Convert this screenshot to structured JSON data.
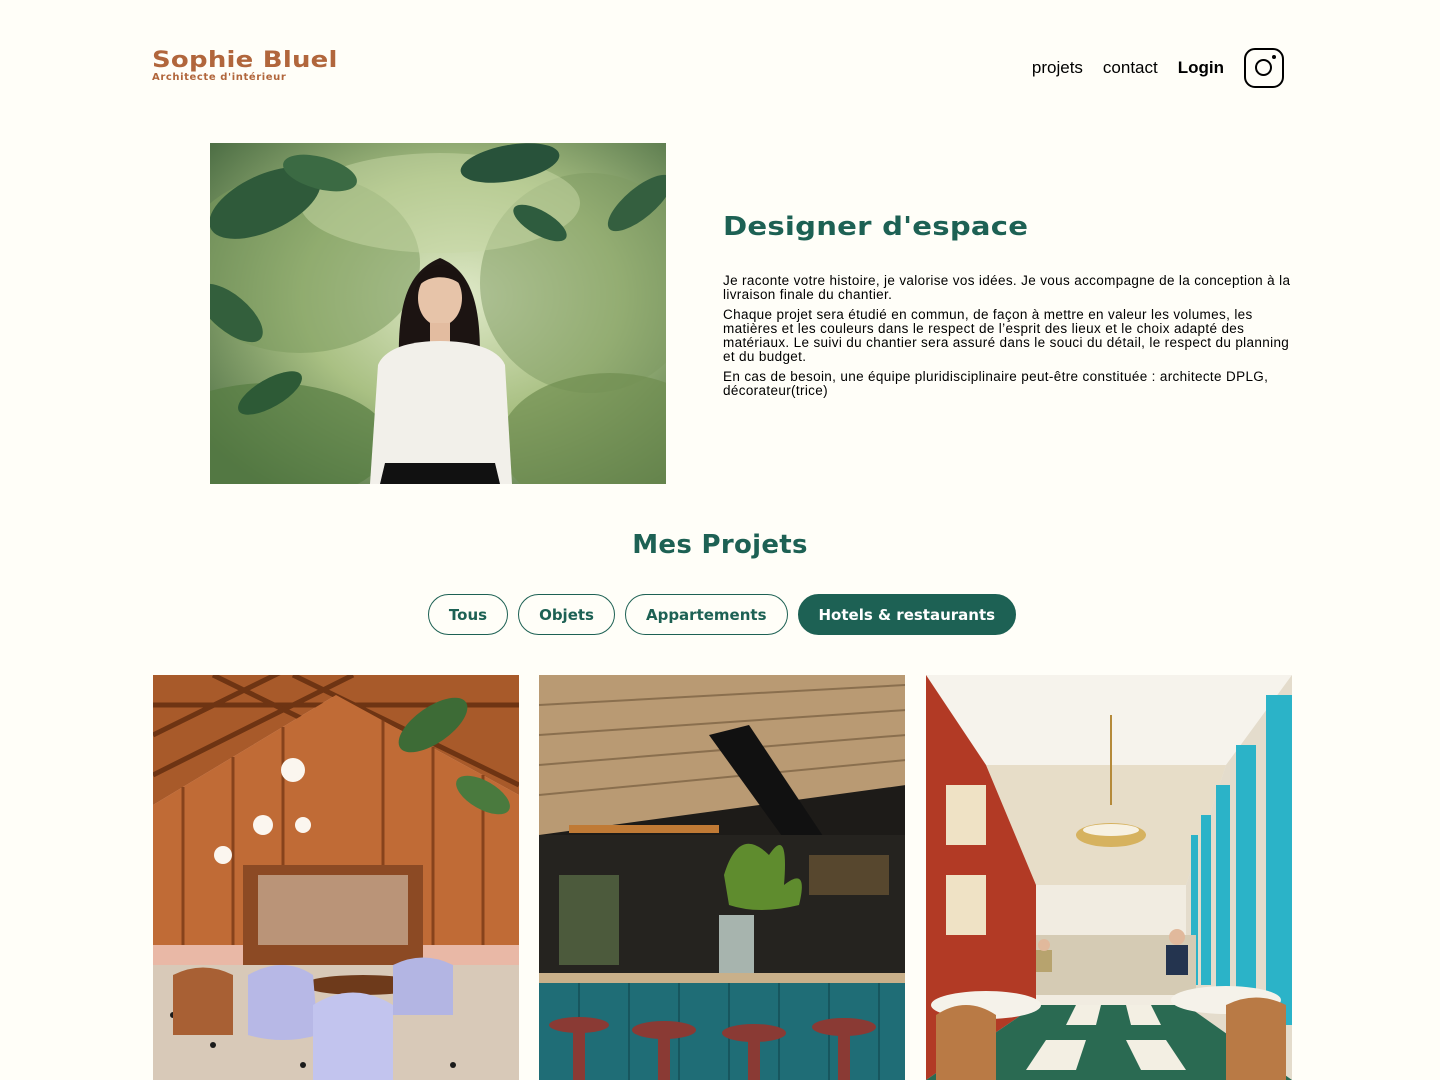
{
  "header": {
    "logo_title": "Sophie Bluel",
    "logo_subtitle": "Architecte d'intérieur",
    "nav": [
      "projets",
      "contact",
      "Login"
    ],
    "instagram_icon": "instagram-icon"
  },
  "intro": {
    "title": "Designer d'espace",
    "paragraphs": [
      "Je raconte votre histoire, je valorise vos idées. Je vous accompagne de la conception à la livraison finale du chantier.",
      "Chaque projet sera étudié en commun, de façon à mettre en valeur les volumes, les matières et les couleurs dans le respect de l’esprit des lieux et le choix adapté des matériaux. Le suivi du chantier sera assuré dans le souci du détail, le respect du planning et du budget.",
      "En cas de besoin, une équipe pluridisciplinaire peut-être constituée : architecte DPLG, décorateur(trice)"
    ]
  },
  "projects": {
    "title": "Mes Projets",
    "filters": [
      "Tous",
      "Objets",
      "Appartements",
      "Hotels & restaurants"
    ],
    "active_filter": "Hotels & restaurants"
  },
  "colors": {
    "accent": "#1D6154",
    "brand": "#B1663C",
    "background": "#FFFEF8"
  }
}
